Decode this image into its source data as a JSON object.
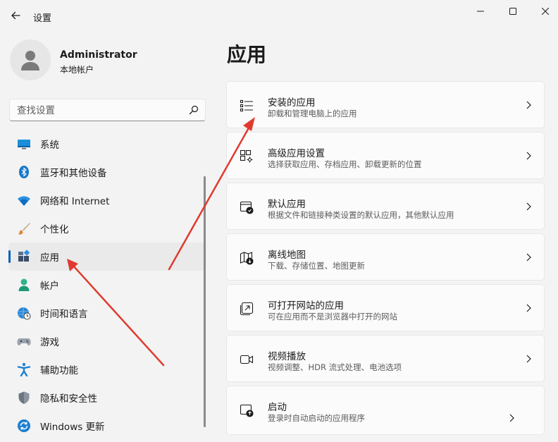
{
  "window": {
    "title": "设置",
    "controls": [
      "minimize-icon",
      "maximize-icon",
      "close-icon"
    ]
  },
  "profile": {
    "name": "Administrator",
    "account_type": "本地帐户"
  },
  "search": {
    "placeholder": "查找设置"
  },
  "sidebar": {
    "items": [
      {
        "label": "系统",
        "icon": "system-display-icon"
      },
      {
        "label": "蓝牙和其他设备",
        "icon": "bluetooth-icon"
      },
      {
        "label": "网络和 Internet",
        "icon": "wifi-icon"
      },
      {
        "label": "个性化",
        "icon": "brush-icon"
      },
      {
        "label": "应用",
        "icon": "apps-icon",
        "active": true
      },
      {
        "label": "帐户",
        "icon": "account-icon"
      },
      {
        "label": "时间和语言",
        "icon": "globe-clock-icon"
      },
      {
        "label": "游戏",
        "icon": "gamepad-icon"
      },
      {
        "label": "辅助功能",
        "icon": "accessibility-icon"
      },
      {
        "label": "隐私和安全性",
        "icon": "shield-icon"
      },
      {
        "label": "Windows 更新",
        "icon": "update-icon"
      }
    ]
  },
  "main": {
    "title": "应用",
    "cards": [
      {
        "title": "安装的应用",
        "subtitle": "卸载和管理电脑上的应用",
        "icon": "list-icon"
      },
      {
        "title": "高级应用设置",
        "subtitle": "选择获取应用、存档应用、卸载更新的位置",
        "icon": "app-settings-icon"
      },
      {
        "title": "默认应用",
        "subtitle": "根据文件和链接种类设置的默认应用，其他默认应用",
        "icon": "default-app-icon"
      },
      {
        "title": "离线地图",
        "subtitle": "下载、存储位置、地图更新",
        "icon": "map-download-icon"
      },
      {
        "title": "可打开网站的应用",
        "subtitle": "可在应用而不是浏览器中打开的网站",
        "icon": "open-website-icon"
      },
      {
        "title": "视频播放",
        "subtitle": "视频调整、HDR 流式处理、电池选项",
        "icon": "video-icon"
      },
      {
        "title": "启动",
        "subtitle": "登录时自动启动的应用程序",
        "icon": "startup-icon"
      }
    ]
  },
  "colors": {
    "accent": "#005fb8",
    "annotation_arrow": "#e03a2f"
  }
}
